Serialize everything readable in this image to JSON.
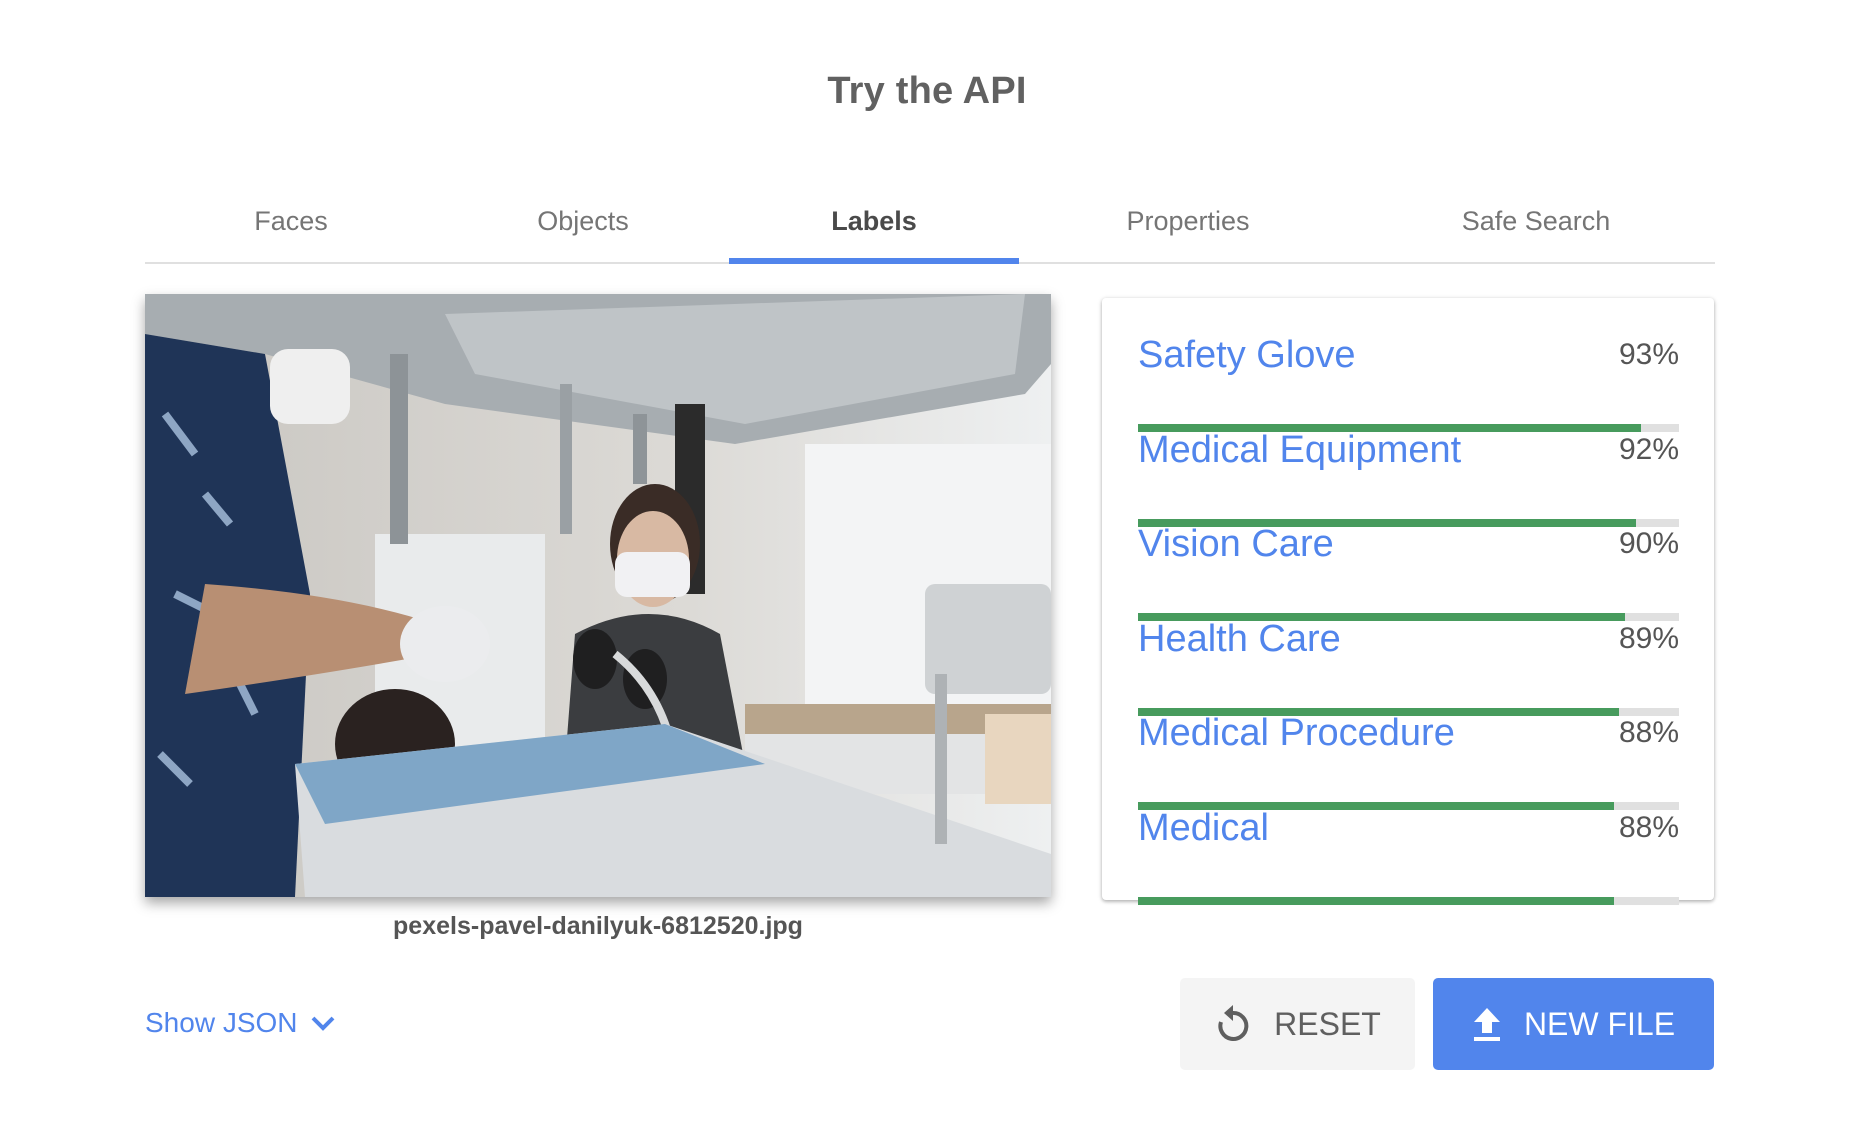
{
  "header": {
    "title": "Try the API"
  },
  "tabs": [
    {
      "label": "Faces",
      "active": false
    },
    {
      "label": "Objects",
      "active": false
    },
    {
      "label": "Labels",
      "active": true
    },
    {
      "label": "Properties",
      "active": false
    },
    {
      "label": "Safe Search",
      "active": false
    }
  ],
  "image": {
    "filename": "pexels-pavel-danilyuk-6812520.jpg",
    "description": "Dental procedure photo: dentist in blue scrubs and masked assistant with black gloves treating a patient"
  },
  "labels": [
    {
      "name": "Safety Glove",
      "score": 93,
      "score_text": "93%"
    },
    {
      "name": "Medical Equipment",
      "score": 92,
      "score_text": "92%"
    },
    {
      "name": "Vision Care",
      "score": 90,
      "score_text": "90%"
    },
    {
      "name": "Health Care",
      "score": 89,
      "score_text": "89%"
    },
    {
      "name": "Medical Procedure",
      "score": 88,
      "score_text": "88%"
    },
    {
      "name": "Medical",
      "score": 88,
      "score_text": "88%"
    }
  ],
  "actions": {
    "show_json_label": "Show JSON",
    "reset_label": "RESET",
    "new_file_label": "NEW FILE"
  },
  "colors": {
    "accent": "#5185ec",
    "bar_fill": "#479b5d",
    "bar_track": "#e0e0e0",
    "reset_bg": "#f4f4f4"
  }
}
